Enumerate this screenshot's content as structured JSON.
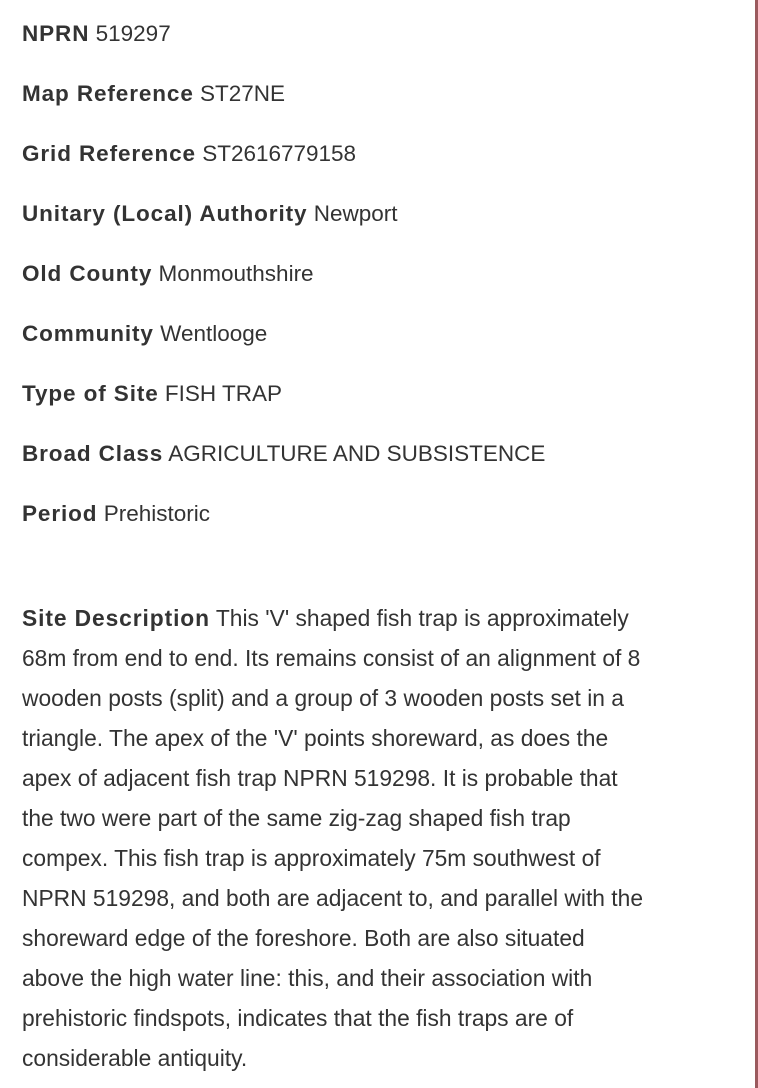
{
  "record": {
    "fields": [
      {
        "label": "NPRN",
        "value": "519297"
      },
      {
        "label": "Map Reference",
        "value": "ST27NE"
      },
      {
        "label": "Grid Reference",
        "value": "ST2616779158"
      },
      {
        "label": "Unitary (Local) Authority",
        "value": "Newport"
      },
      {
        "label": "Old County",
        "value": "Monmouthshire"
      },
      {
        "label": "Community",
        "value": "Wentlooge"
      },
      {
        "label": "Type of Site",
        "value": "FISH TRAP"
      },
      {
        "label": "Broad Class",
        "value": "AGRICULTURE AND SUBSISTENCE"
      },
      {
        "label": "Period",
        "value": "Prehistoric"
      }
    ],
    "site_description": {
      "label": "Site Description",
      "lines": [
        "This 'V' shaped fish trap is approximately",
        "68m from end to end. Its remains consist of an alignment of 8",
        "wooden posts (split) and a group of 3 wooden posts set in a",
        "triangle. The apex of the 'V' points shoreward, as does the",
        "apex of adjacent fish trap NPRN 519298. It is probable that",
        "the two were part of the same zig-zag shaped fish trap",
        "compex. This fish trap is approximately 75m southwest of",
        "NPRN 519298, and both are adjacent to, and parallel with the",
        "shoreward edge of the foreshore. Both are also situated",
        "above the high water line: this, and their association with",
        "prehistoric findspots, indicates that the fish traps are of",
        "considerable antiquity."
      ]
    }
  },
  "colors": {
    "text": "#333333",
    "border_accent": "#9b5a5e",
    "background": "#ffffff"
  }
}
